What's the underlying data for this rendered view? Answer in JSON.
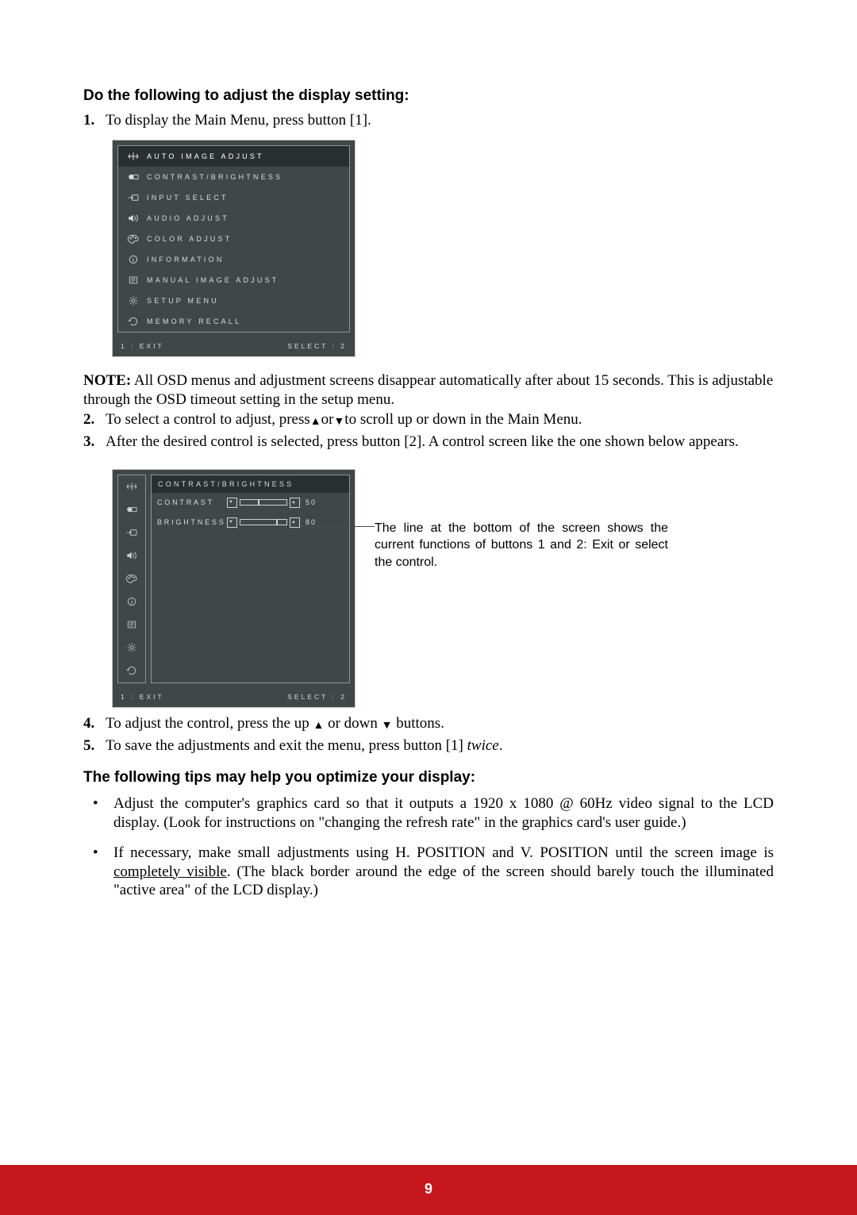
{
  "heading1": "Do the following to adjust the display setting:",
  "steps_top": [
    {
      "n": "1.",
      "t": "To display the Main Menu, press button [1]."
    }
  ],
  "osd1": {
    "items": [
      {
        "id": "auto-image-adjust",
        "label": "AUTO IMAGE ADJUST",
        "selected": true
      },
      {
        "id": "contrast-brightness",
        "label": "CONTRAST/BRIGHTNESS",
        "selected": false
      },
      {
        "id": "input-select",
        "label": "INPUT SELECT",
        "selected": false
      },
      {
        "id": "audio-adjust",
        "label": "AUDIO ADJUST",
        "selected": false
      },
      {
        "id": "color-adjust",
        "label": "COLOR ADJUST",
        "selected": false
      },
      {
        "id": "information",
        "label": "INFORMATION",
        "selected": false
      },
      {
        "id": "manual-image-adjust",
        "label": "MANUAL IMAGE ADJUST",
        "selected": false
      },
      {
        "id": "setup-menu",
        "label": "SETUP MENU",
        "selected": false
      },
      {
        "id": "memory-recall",
        "label": "MEMORY RECALL",
        "selected": false
      }
    ],
    "footer": {
      "left": "1 : EXIT",
      "right": "SELECT : 2"
    }
  },
  "note": {
    "label": "NOTE:",
    "text": " All OSD menus and adjustment screens disappear automatically after about 15 seconds. This is adjustable through the OSD timeout setting in the setup menu."
  },
  "steps_mid": [
    {
      "n": "2.",
      "t_pre": "To select a control to adjust, press",
      "t_post": "to scroll up or down in the Main Menu."
    },
    {
      "n": "3.",
      "t": "After the desired control is selected, press button [2]. A control screen like the one shown below appears."
    }
  ],
  "osd2": {
    "header": "CONTRAST/BRIGHTNESS",
    "rows": [
      {
        "label": "CONTRAST",
        "value": "50",
        "pos": 0.38
      },
      {
        "label": "BRIGHTNESS",
        "value": "80",
        "pos": 0.78
      }
    ],
    "footer": {
      "left": "1 : EXIT",
      "right": "SELECT : 2"
    }
  },
  "callout": "The line at the bottom of the screen shows the current functions of buttons 1 and 2: Exit or select the control.",
  "steps_bottom": [
    {
      "n": "4.",
      "t_pre": "To adjust the control, press the up ",
      "t_mid": " or down ",
      "t_post": " buttons."
    },
    {
      "n": "5.",
      "t_pre": "To save the adjustments and exit the menu, press button [1] ",
      "t_em": "twice",
      "t_post": "."
    }
  ],
  "heading2": "The following tips may help you optimize your display:",
  "tips": [
    "Adjust the computer's graphics card so that it outputs a 1920 x 1080 @ 60Hz video signal to the LCD display. (Look for instructions on \"changing the refresh rate\" in the graphics card's user guide.)",
    "If necessary, make small adjustments using H. POSITION and V. POSITION until the screen image is <u>completely visible</u>. (The black border around the edge of the screen should barely touch the illuminated \"active area\" of the LCD display.)"
  ],
  "page_number": "9"
}
